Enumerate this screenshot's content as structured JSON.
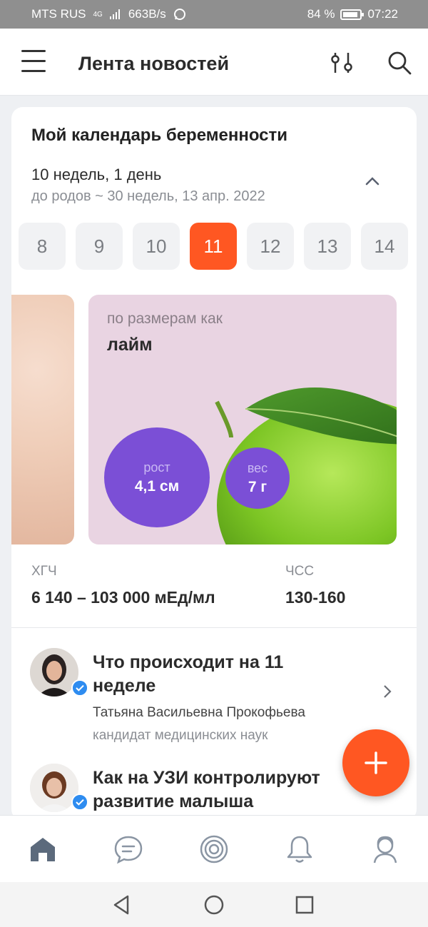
{
  "status_bar": {
    "carrier": "MTS RUS",
    "network": "4G",
    "speed": "663B/s",
    "battery": "84 %",
    "time": "07:22"
  },
  "header": {
    "title": "Лента новостей",
    "menu_icon": "hamburger-icon",
    "filter_icon": "filter-sliders-icon",
    "search_icon": "search-icon"
  },
  "calendar": {
    "title": "Мой календарь беременности",
    "current": "10 недель, 1 день",
    "remaining": "до родов ~ 30 недель, 13 апр. 2022",
    "weeks": [
      "8",
      "9",
      "10",
      "11",
      "12",
      "13",
      "14"
    ],
    "selected_week": "11",
    "fruit": {
      "caption": "по размерам как",
      "name": "лайм",
      "height_label": "рост",
      "height_value": "4,1 см",
      "weight_label": "вес",
      "weight_value": "7 г"
    },
    "stats": {
      "hcg_label": "ХГЧ",
      "hcg_value": "6 140 – 103 000 мЕд/мл",
      "hr_label": "ЧСС",
      "hr_value": "130-160"
    }
  },
  "articles": [
    {
      "title": "Что происходит на 11 неделе",
      "author": "Татьяна Васильевна Прокофьева",
      "role": "кандидат медицинских наук"
    },
    {
      "title": "Как на УЗИ контролируют развитие малыша"
    }
  ],
  "fab_icon": "plus-icon",
  "bottom_nav": [
    "home-icon",
    "chat-icon",
    "target-icon",
    "bell-icon",
    "profile-icon"
  ],
  "colors": {
    "accent": "#ff5722",
    "purple": "#7b4fd6",
    "fruit_bg": "#e9d4e2"
  }
}
